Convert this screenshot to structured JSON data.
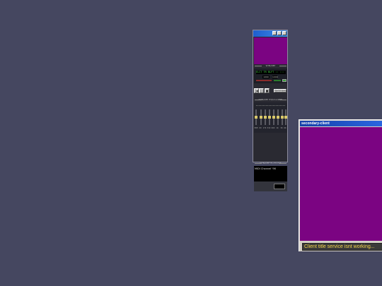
{
  "winamp": {
    "section_main": "WINAMP",
    "display_text": "ELCT TR BLFT  :: :::",
    "kbps": "1000",
    "khz": "1000",
    "control_labels": [
      "|◀",
      "▶",
      "||",
      "■",
      "▶|"
    ],
    "eject_label": "Eject/Open",
    "section_eq": "WINAMP EQUALIZER",
    "eq_bands": [
      "PRE",
      "60",
      "170",
      "310",
      "600",
      "1K",
      "3K",
      "6K",
      "12K",
      "14K",
      "16K"
    ],
    "section_playlist": "WINAMP PLAYLIST",
    "playlist_items": [
      "MIDI Channel '96"
    ]
  },
  "secondary": {
    "title": "secondary-client",
    "status": "Client title service isnt working..."
  },
  "colors": {
    "desktop": "#454760",
    "video": "#7b0482",
    "titlebar": "#1f5ecf"
  }
}
